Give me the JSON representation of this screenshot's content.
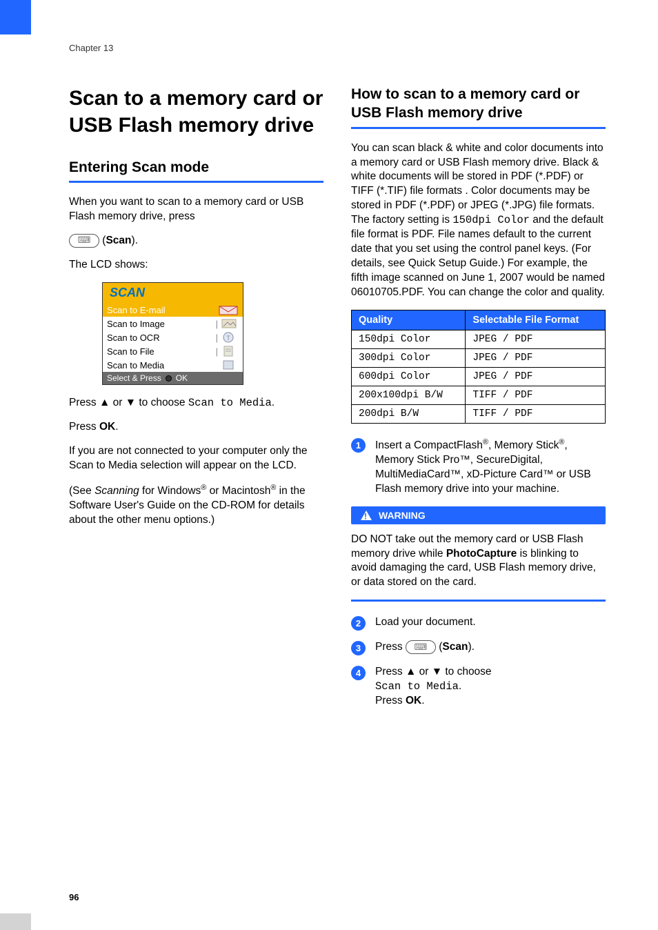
{
  "chapter": "Chapter 13",
  "page_number": "96",
  "left": {
    "h1": "Scan to a memory card or USB Flash memory drive",
    "h2": "Entering Scan mode",
    "p1a": "When you want to scan to a memory card or USB Flash memory drive, press",
    "p1b_scan": "Scan",
    "p2": "The LCD shows:",
    "lcd": {
      "title": "SCAN",
      "items": [
        "Scan to E-mail",
        "Scan to Image",
        "Scan to OCR",
        "Scan to File",
        "Scan to Media"
      ],
      "footer_left": "Select & Press",
      "footer_right": "OK"
    },
    "p3_pre": "Press ",
    "p3_choose": " to choose ",
    "p3_value": "Scan to Media",
    "p4_pre": "Press ",
    "p4_ok": "OK",
    "p5": "If you are not connected to your computer only the Scan to Media selection will appear on the LCD.",
    "p6_pre": "(See ",
    "p6_em": "Scanning",
    "p6_mid": " for Windows",
    "p6_or": " or Macintosh",
    "p6_end": " in the Software User's Guide on the CD-ROM for details about the other menu options.)"
  },
  "right": {
    "h2": "How to scan to a memory card or USB Flash memory drive",
    "p1a": "You can scan black & white and color documents into a memory card or USB Flash memory drive. Black & white documents will be stored in PDF (*.PDF) or TIFF (*.TIF) file formats . Color documents may be stored in PDF (*.PDF) or JPEG (*.JPG) file formats. The factory setting is ",
    "p1_mono": "150dpi Color",
    "p1b": " and the default file format is PDF. File names default to the current date that you set using the control panel keys. (For details, see Quick Setup Guide.) For example, the fifth image scanned on June 1, 2007 would be named 06010705.PDF. You can change the color and quality.",
    "table": {
      "h1": "Quality",
      "h2": "Selectable File Format",
      "rows": [
        [
          "150dpi Color",
          "JPEG / PDF"
        ],
        [
          "300dpi Color",
          "JPEG / PDF"
        ],
        [
          "600dpi Color",
          "JPEG / PDF"
        ],
        [
          "200x100dpi B/W",
          "TIFF / PDF"
        ],
        [
          "200dpi B/W",
          "TIFF / PDF"
        ]
      ]
    },
    "step1_a": "Insert a CompactFlash",
    "step1_b": ", Memory Stick",
    "step1_c": ", Memory Stick Pro™, SecureDigital, MultiMediaCard™, xD-Picture Card™ or USB Flash memory drive into your machine.",
    "warning_label": "WARNING",
    "warning_a": "DO NOT take out the memory card or USB Flash memory drive while ",
    "warning_bold": "PhotoCapture",
    "warning_b": " is blinking to avoid damaging the card, USB Flash memory drive, or data stored on the card.",
    "step2": "Load your document.",
    "step3_pre": "Press ",
    "step3_scan": "Scan",
    "step4_pre": "Press ",
    "step4_choose": " to choose",
    "step4_value": "Scan to Media",
    "step4_press": "Press ",
    "step4_ok": "OK"
  }
}
